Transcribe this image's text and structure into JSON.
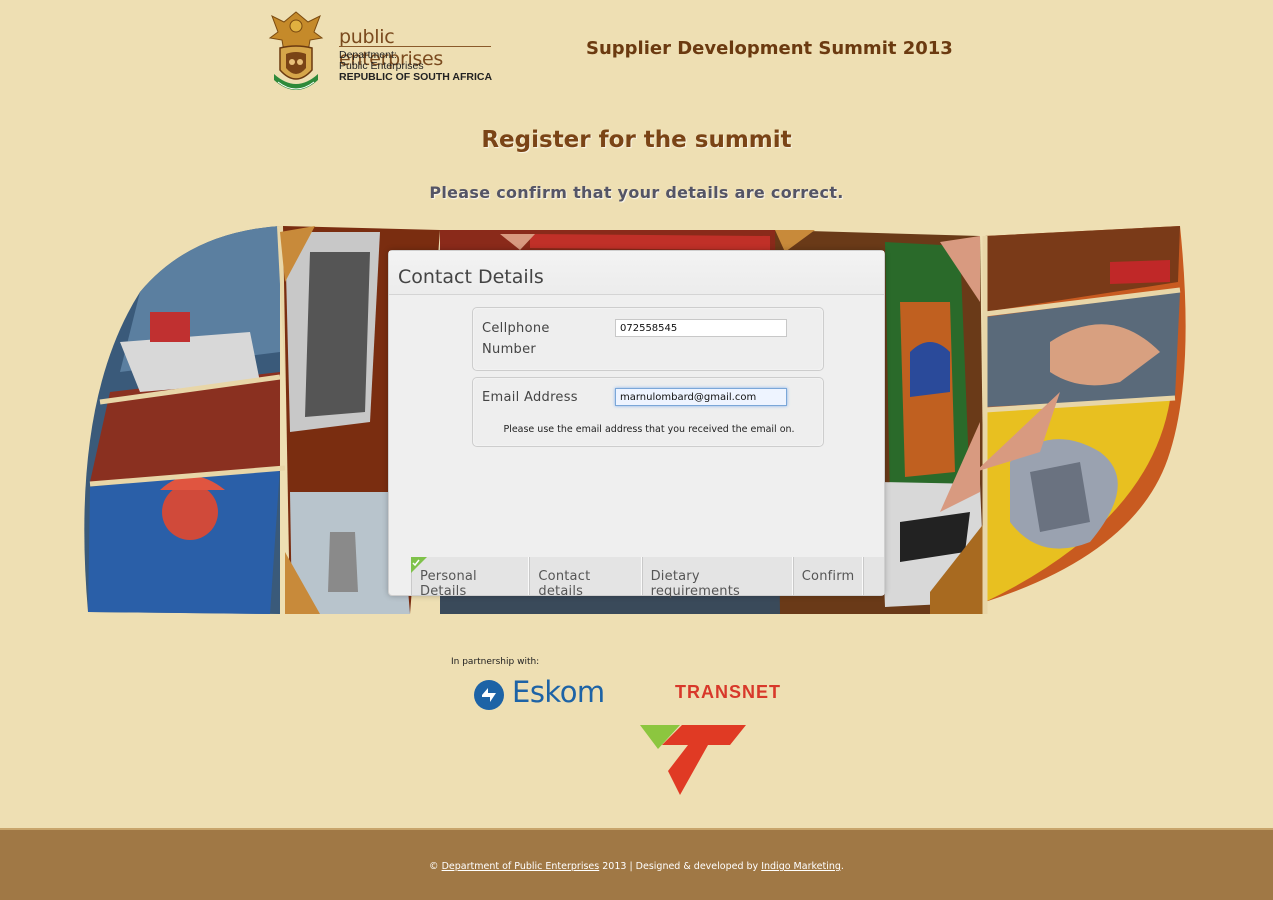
{
  "header": {
    "logo_title": "public enterprises",
    "logo_line1": "Department:",
    "logo_line2": "Public Enterprises",
    "logo_line3": "REPUBLIC OF SOUTH AFRICA",
    "event_title": "Supplier Development Summit 2013"
  },
  "page": {
    "title": "Register for the summit",
    "subtitle": "Please confirm that your details are correct."
  },
  "form": {
    "heading": "Contact Details",
    "cellphone_label": "Cellphone Number",
    "cellphone_value": "072558545",
    "email_label": "Email Address",
    "email_value": "marnulombard@gmail.com",
    "email_hint": "Please use the email address that you received the email on."
  },
  "steps": [
    {
      "label": "Personal Details",
      "completed": true
    },
    {
      "label": "Contact details",
      "completed": false
    },
    {
      "label": "Dietary requirements",
      "completed": false
    },
    {
      "label": "Confirm",
      "completed": false
    }
  ],
  "partners": {
    "label": "In partnership with:",
    "eskom": "Eskom",
    "transnet": "TRANSNET"
  },
  "footer": {
    "copyright": "©",
    "dpe_link": "Department of Public Enterprises",
    "middle": "2013 | Designed & developed by",
    "indigo_link": "Indigo Marketing",
    "end": "."
  },
  "colors": {
    "background": "#eedfb3",
    "title_brown": "#7a4416",
    "footer_brown": "#a07845",
    "eskom_blue": "#1d63a6",
    "transnet_red": "#d8382a"
  }
}
